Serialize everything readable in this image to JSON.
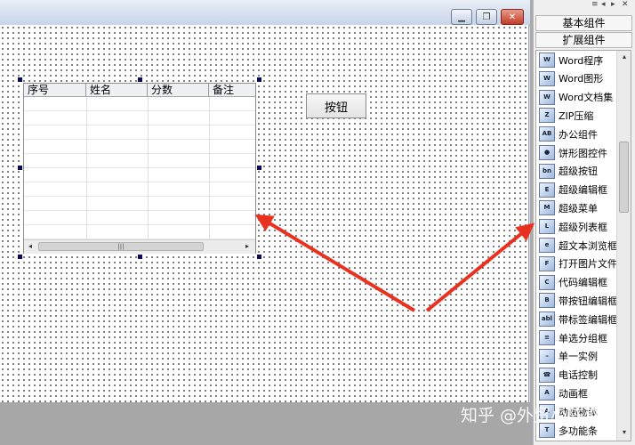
{
  "window": {
    "minimize_icon": "minimize-icon",
    "restore_icon": "restore-icon",
    "close_icon": "close-icon"
  },
  "grid_table": {
    "columns": [
      "序号",
      "姓名",
      "分数",
      "备注"
    ],
    "scroll_left": "◂",
    "scroll_right": "▸",
    "thumb_grip": "|||"
  },
  "button": {
    "label": "按钮"
  },
  "panel": {
    "top_icons": [
      "≡",
      "◂",
      "▸",
      "✕"
    ],
    "groups": [
      "基本组件",
      "扩展组件"
    ],
    "scroll_up": "▴",
    "scroll_down": "▾",
    "items": [
      {
        "label": "Word程序",
        "icon": "W"
      },
      {
        "label": "Word图形",
        "icon": "W"
      },
      {
        "label": "Word文档集",
        "icon": "W"
      },
      {
        "label": "ZIP压缩",
        "icon": "Z"
      },
      {
        "label": "办公组件",
        "icon": "AB"
      },
      {
        "label": "饼形图控件",
        "icon": "●"
      },
      {
        "label": "超级按钮",
        "icon": "bn"
      },
      {
        "label": "超级编辑框",
        "icon": "E"
      },
      {
        "label": "超级菜单",
        "icon": "M"
      },
      {
        "label": "超级列表框",
        "icon": "L"
      },
      {
        "label": "超文本浏览框",
        "icon": "e"
      },
      {
        "label": "打开图片文件",
        "icon": "F"
      },
      {
        "label": "代码编辑框",
        "icon": "C"
      },
      {
        "label": "带按钮编辑框",
        "icon": "B"
      },
      {
        "label": "带标签编辑框",
        "icon": "abl"
      },
      {
        "label": "单选分组框",
        "icon": "≡"
      },
      {
        "label": "单一实例",
        "icon": "–"
      },
      {
        "label": "电话控制",
        "icon": "☎"
      },
      {
        "label": "动画框",
        "icon": "A"
      },
      {
        "label": "动画物体",
        "icon": "A"
      },
      {
        "label": "多功能条",
        "icon": "T"
      }
    ]
  },
  "watermark": "知乎 @外贸小陈惑",
  "colors": {
    "arrow": "#e8321f",
    "selection_handle": "#0c0c5a"
  }
}
